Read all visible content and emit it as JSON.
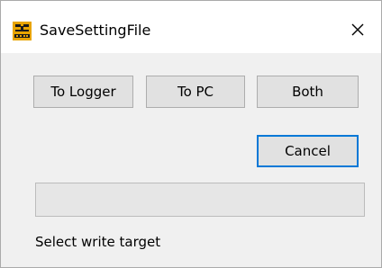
{
  "window": {
    "title": "SaveSettingFile",
    "app_icon": "data-logger-icon",
    "close_icon": "close-icon"
  },
  "buttons": {
    "to_logger": "To Logger",
    "to_pc": "To PC",
    "both": "Both",
    "cancel": "Cancel"
  },
  "progress": {
    "value": 0
  },
  "status": {
    "text": "Select write target"
  },
  "colors": {
    "app_icon_bg": "#e8a400",
    "app_icon_fg": "#1a1a1a",
    "focus_border": "#0078d7"
  }
}
